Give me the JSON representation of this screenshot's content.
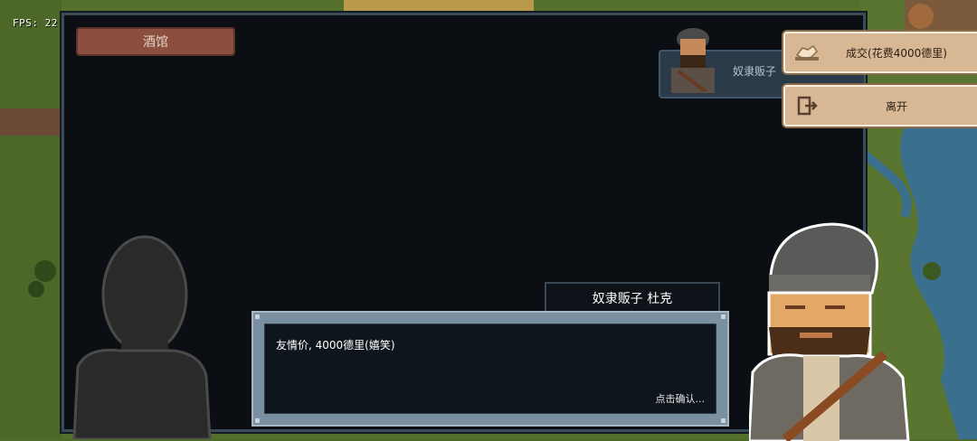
{
  "hud": {
    "fps": "FPS: 22"
  },
  "panel": {
    "tavern_title": "酒馆"
  },
  "npc_card": {
    "name": "奴隶贩子"
  },
  "menu": {
    "deal_label": "成交(花费4000德里)",
    "leave_label": "离开"
  },
  "dialog": {
    "speaker": "奴隶贩子 杜克",
    "text": "友情价, 4000德里(嬉笑)",
    "continue_hint": "点击确认..."
  },
  "icons": {
    "deal": "handshake-icon",
    "leave": "exit-door-icon"
  }
}
